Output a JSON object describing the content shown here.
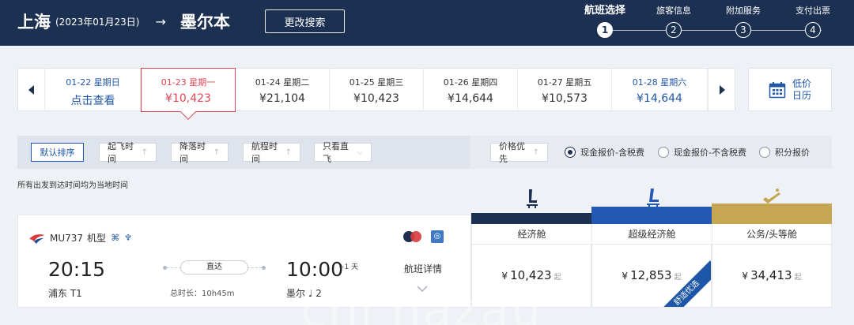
{
  "header": {
    "origin": "上海",
    "date": "(2023年01月23日)",
    "arrow": "→",
    "destination": "墨尔本",
    "modify_label": "更改搜索",
    "steps": [
      {
        "label": "航班选择",
        "num": "1"
      },
      {
        "label": "旅客信息",
        "num": "2"
      },
      {
        "label": "附加服务",
        "num": "3"
      },
      {
        "label": "支付出票",
        "num": "4"
      }
    ]
  },
  "date_strip": {
    "cells": [
      {
        "date": "01-22 星期日",
        "price": "点击查看"
      },
      {
        "date": "01-23 星期一",
        "price": "¥10,423"
      },
      {
        "date": "01-24 星期二",
        "price": "¥21,104"
      },
      {
        "date": "01-25 星期三",
        "price": "¥10,423"
      },
      {
        "date": "01-26 星期四",
        "price": "¥14,644"
      },
      {
        "date": "01-27 星期五",
        "price": "¥10,573"
      },
      {
        "date": "01-28 星期六",
        "price": "¥14,644"
      }
    ],
    "calendar_line1": "低价",
    "calendar_line2": "日历"
  },
  "filters": {
    "default_sort": "默认排序",
    "depart_time": "起飞时间",
    "arrive_time": "降落时间",
    "duration": "航程时间",
    "direct_only": "只看直飞",
    "price_first": "价格优先",
    "radios": [
      "现金报价-含税费",
      "现金报价-不含税费",
      "积分报价"
    ]
  },
  "note": "所有出发到达时间均为当地时间",
  "cabins": [
    {
      "name": "经济舱",
      "price": "10,423",
      "color": "#1c3152"
    },
    {
      "name": "超级经济舱",
      "price": "12,853",
      "color": "#2458b5",
      "ribbon": "舒适优选"
    },
    {
      "name": "公务/头等舱",
      "price": "34,413",
      "color": "#c4a653"
    }
  ],
  "price_prefix": "¥",
  "price_suffix": "起",
  "flight": {
    "number": "MU737",
    "aircraft": "机型",
    "dep_time": "20:15",
    "dep_terminal": "浦东 T1",
    "direct": "直达",
    "duration": "总时长：10h45m",
    "arr_time": "10:00",
    "plus_day": "+1 天",
    "arr_terminal": "墨尔 ♩ 2",
    "detail": "航班详情"
  },
  "watermark": "chi hazau"
}
